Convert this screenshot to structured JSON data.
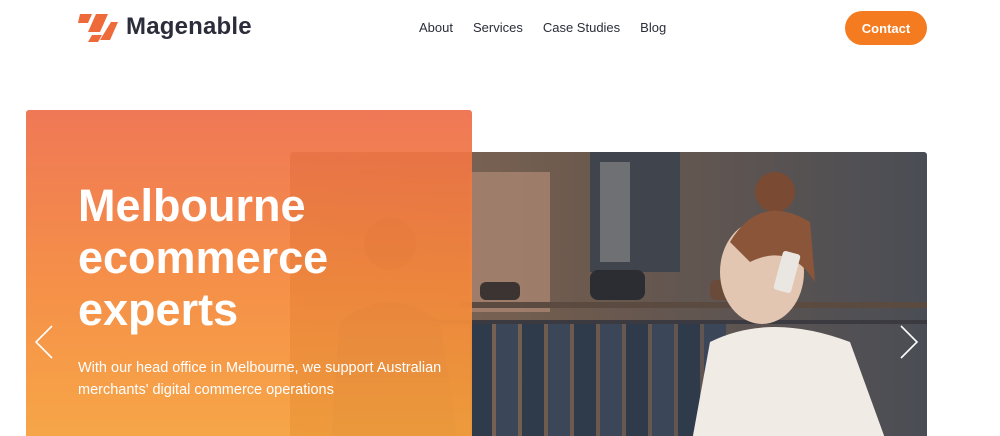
{
  "brand": {
    "name": "Magenable",
    "accent": "#f47b20",
    "logo_color": "#ef6a3a",
    "text_color": "#2b2d3a"
  },
  "nav": {
    "items": [
      {
        "label": "About"
      },
      {
        "label": "Services"
      },
      {
        "label": "Case Studies"
      },
      {
        "label": "Blog"
      }
    ],
    "contact_label": "Contact"
  },
  "hero": {
    "title_lines": [
      "Melbourne",
      "ecommerce",
      "experts"
    ],
    "subtitle": "With our head office in Melbourne, we support Australian merchants' digital commerce operations",
    "icons": {
      "prev": "chevron-left-icon",
      "next": "chevron-right-icon"
    }
  }
}
